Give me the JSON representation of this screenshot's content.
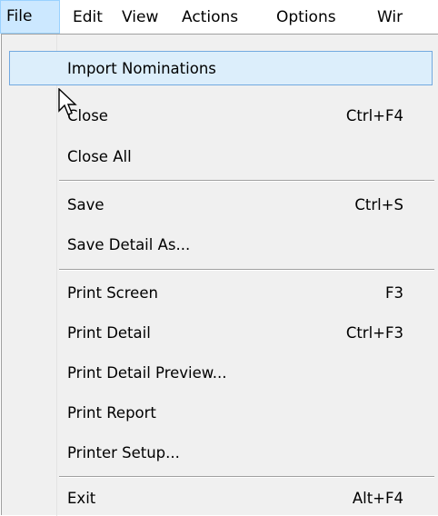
{
  "menubar": {
    "items": [
      {
        "label": "File"
      },
      {
        "label": "Edit"
      },
      {
        "label": "View"
      },
      {
        "label": "Actions"
      },
      {
        "label": "Options"
      },
      {
        "label": "Wir"
      }
    ]
  },
  "file_menu": {
    "items": [
      {
        "label": "Import Nominations",
        "shortcut": ""
      },
      {
        "label": "Close",
        "shortcut": "Ctrl+F4"
      },
      {
        "label": "Close All",
        "shortcut": ""
      },
      {
        "label": "Save",
        "shortcut": "Ctrl+S"
      },
      {
        "label": "Save Detail As...",
        "shortcut": ""
      },
      {
        "label": "Print Screen",
        "shortcut": "F3"
      },
      {
        "label": "Print Detail",
        "shortcut": "Ctrl+F3"
      },
      {
        "label": "Print Detail Preview...",
        "shortcut": ""
      },
      {
        "label": "Print Report",
        "shortcut": ""
      },
      {
        "label": "Printer Setup...",
        "shortcut": ""
      },
      {
        "label": "Exit",
        "shortcut": "Alt+F4"
      }
    ]
  },
  "colors": {
    "menubar_active_bg": "#cce8ff",
    "menu_bg": "#f0f0f0",
    "highlight_bg": "#dceefb",
    "highlight_border": "#72a9e0"
  }
}
